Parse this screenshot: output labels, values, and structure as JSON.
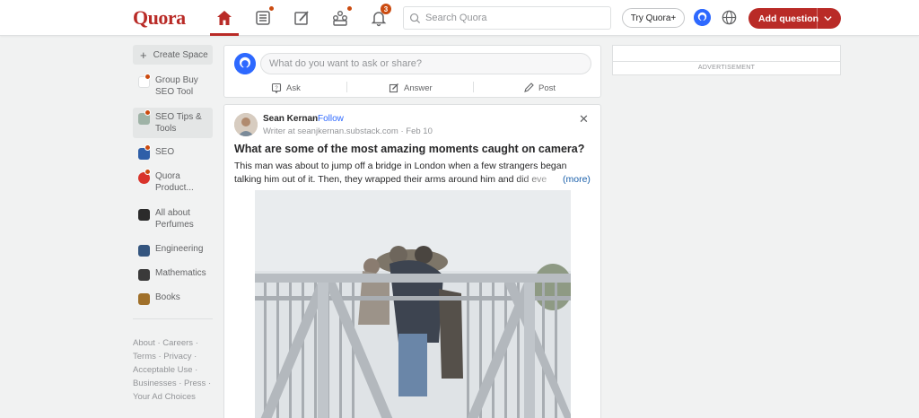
{
  "header": {
    "logo": "Quora",
    "notifications_count": "3",
    "search_placeholder": "Search Quora",
    "try_plus_label": "Try Quora+",
    "add_question_label": "Add question"
  },
  "sidebar": {
    "create_space_label": "Create Space",
    "items": [
      {
        "label": "Group Buy SEO Tool",
        "icon": "group-buy-space-icon"
      },
      {
        "label": "SEO Tips & Tools",
        "icon": "seo-tips-space-icon"
      },
      {
        "label": "SEO",
        "icon": "seo-space-icon"
      },
      {
        "label": "Quora Product...",
        "icon": "quora-product-space-icon"
      },
      {
        "label": "All about Perfumes",
        "icon": "perfumes-space-icon"
      },
      {
        "label": "Engineering",
        "icon": "engineering-space-icon"
      },
      {
        "label": "Mathematics",
        "icon": "mathematics-space-icon"
      },
      {
        "label": "Books",
        "icon": "books-space-icon"
      }
    ],
    "footer": "About · Careers · Terms · Privacy · Acceptable Use · Businesses · Press · Your Ad Choices"
  },
  "ask_box": {
    "placeholder": "What do you want to ask or share?",
    "ask_label": "Ask",
    "answer_label": "Answer",
    "post_label": "Post"
  },
  "post": {
    "author": "Sean Kernan",
    "follow_label": "Follow",
    "dot": "·",
    "credential": "Writer at seanjkernan.substack.com · Feb 10",
    "question": "What are some of the most amazing moments caught on camera?",
    "body": "This man was about to jump off a bridge in London when a few strangers began talking him out of it. Then, they wrapped their arms around him and did eve",
    "more_label": "(more)",
    "close_symbol": "✕"
  },
  "ad": {
    "label": "ADVERTISEMENT"
  },
  "colors": {
    "brand": "#b92b27",
    "link": "#2e69ff",
    "notification": "#cb4b10"
  }
}
